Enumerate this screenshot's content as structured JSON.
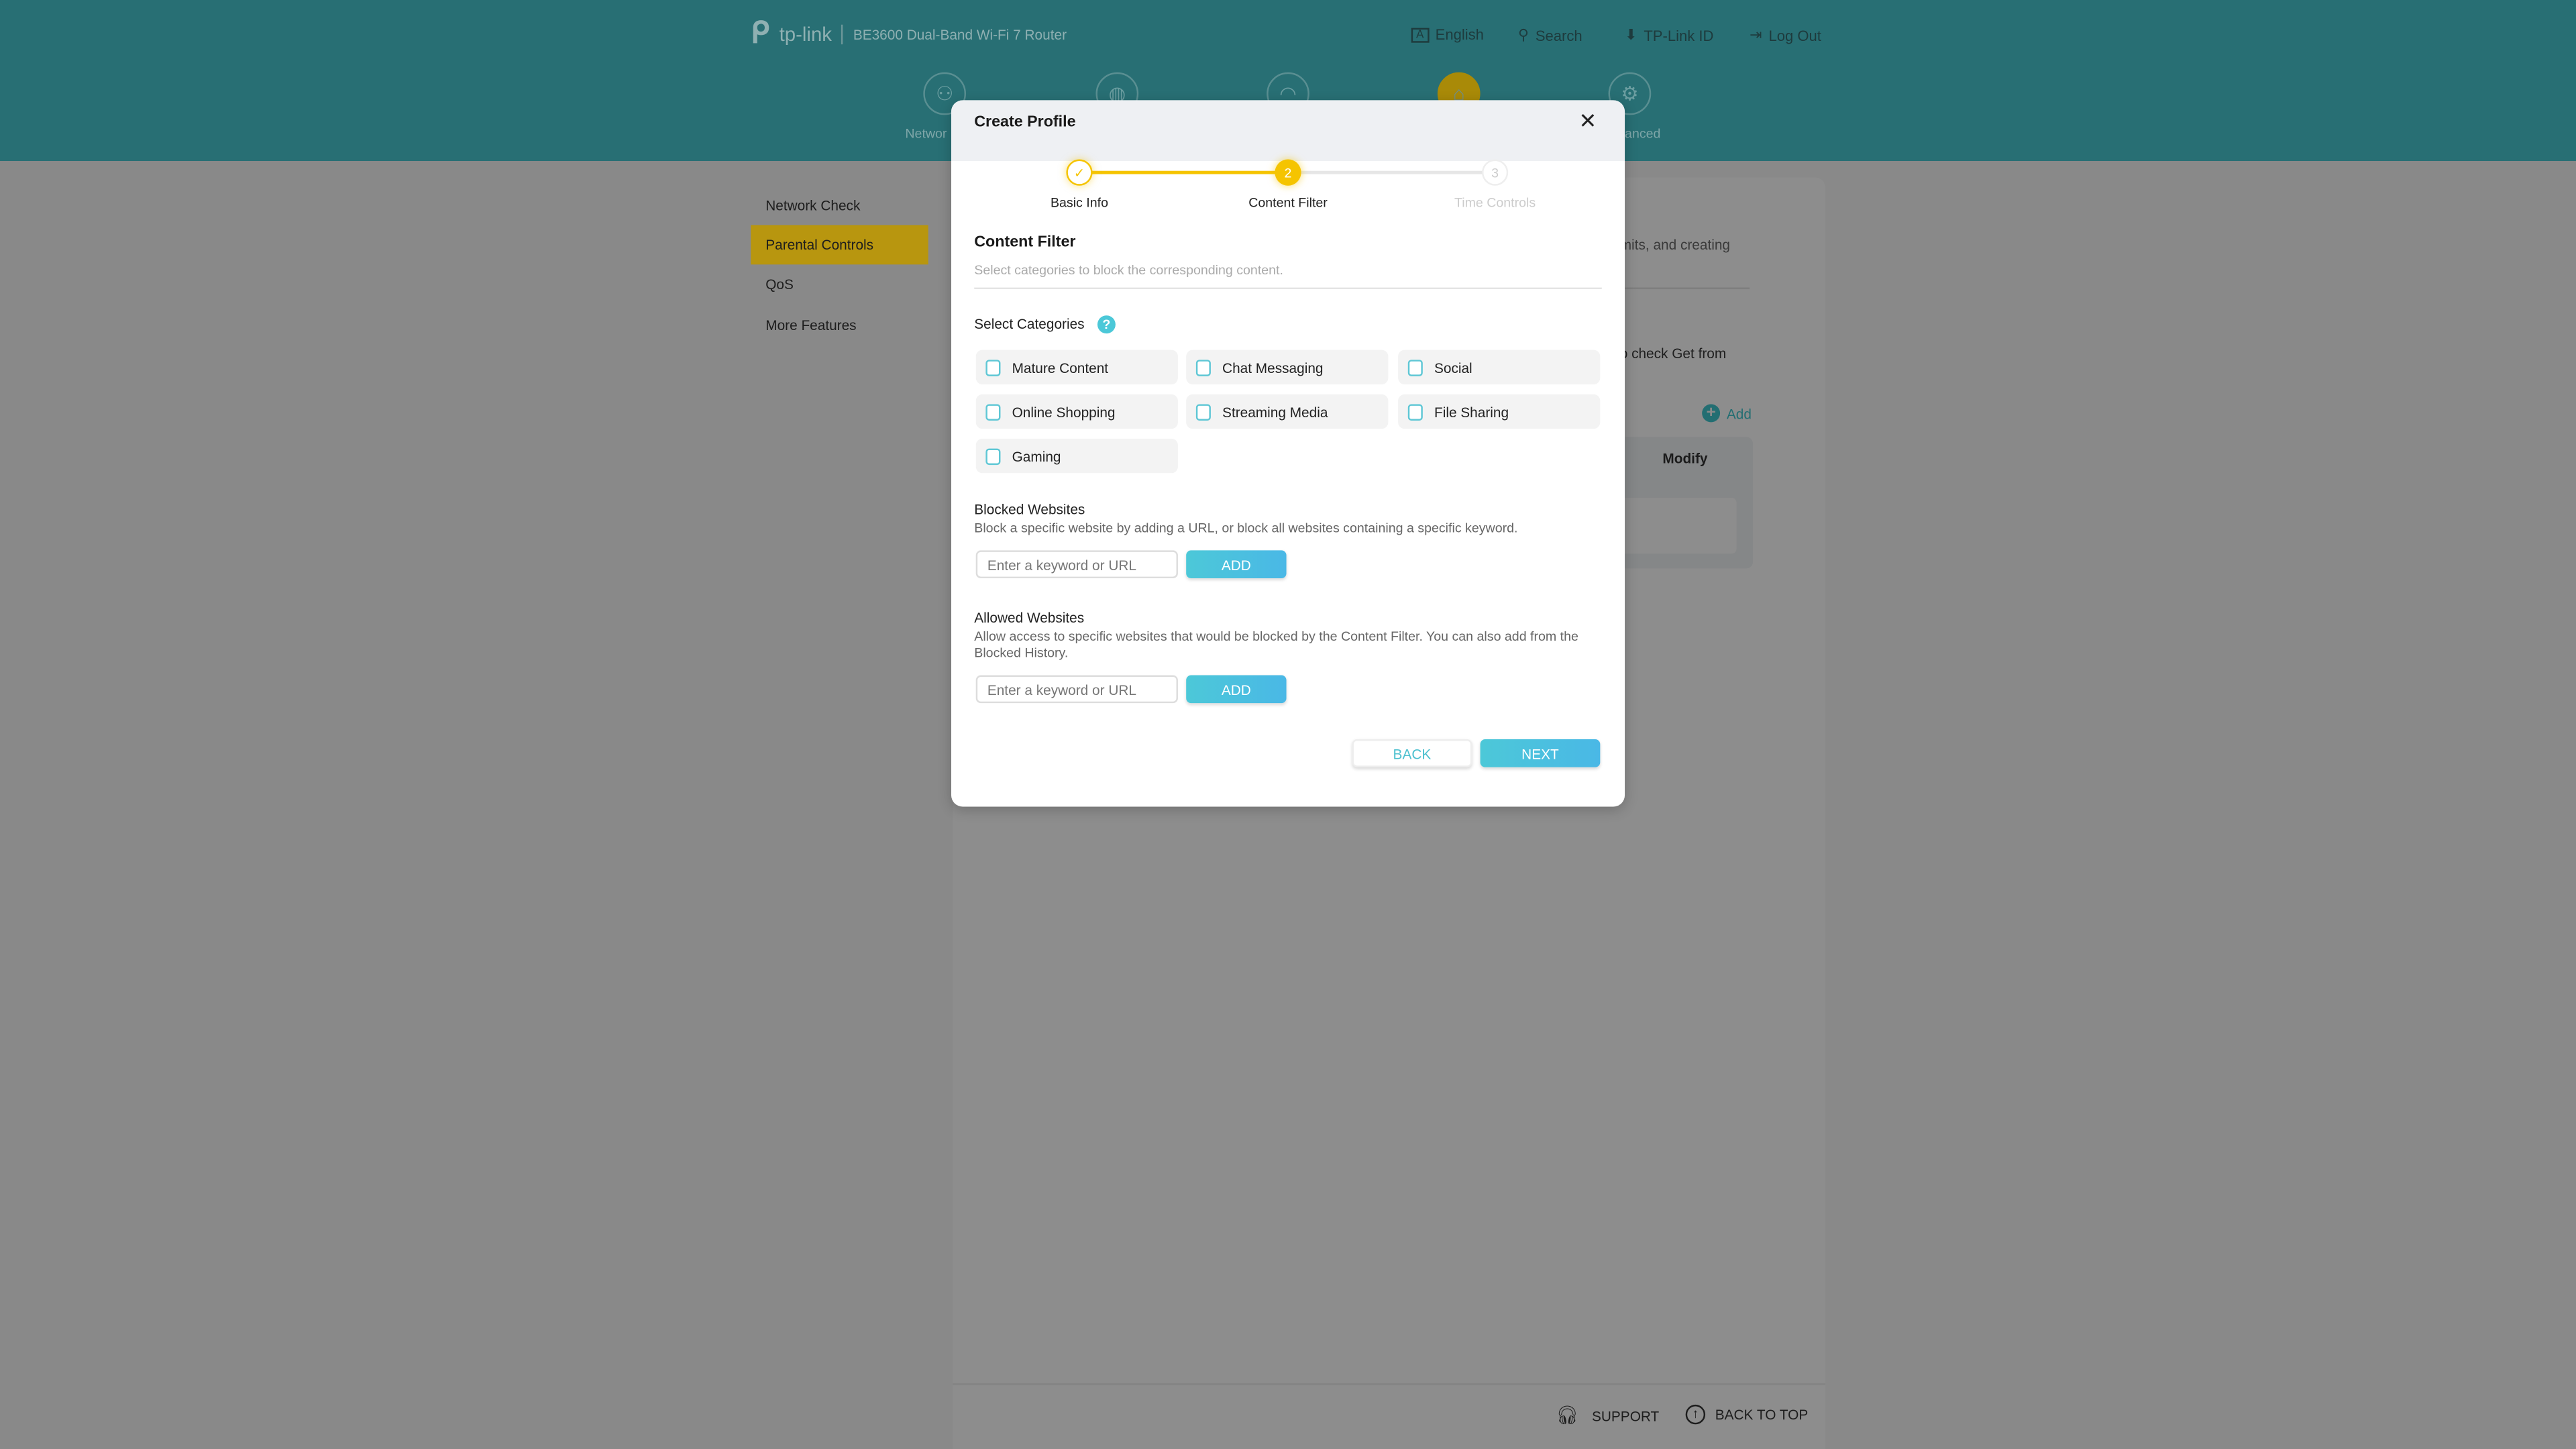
{
  "header": {
    "brand": "tp-link",
    "model": "BE3600 Dual-Band Wi-Fi 7 Router",
    "links": [
      {
        "label": "English",
        "icon": "language-icon"
      },
      {
        "label": "Search",
        "icon": "search-icon"
      },
      {
        "label": "TP-Link ID",
        "icon": "tplink-id-icon"
      },
      {
        "label": "Log Out",
        "icon": "logout-icon"
      }
    ],
    "nav": [
      {
        "label": "Networ",
        "icon": "network-icon"
      },
      {
        "label": "",
        "icon": "internet-icon"
      },
      {
        "label": "",
        "icon": "wireless-icon"
      },
      {
        "label": "",
        "icon": "homeshield-icon",
        "active": true
      },
      {
        "label": "anced",
        "icon": "advanced-icon"
      }
    ]
  },
  "sidebar": {
    "items": [
      {
        "label": "Network Check"
      },
      {
        "label": "Parental Controls",
        "active": true
      },
      {
        "label": "QoS"
      },
      {
        "label": "More Features"
      }
    ]
  },
  "background": {
    "intro_fragment": "mits, and creating",
    "note_fragment": "o check Get from",
    "add_label": "Add",
    "table_header_modify": "Modify"
  },
  "footer": {
    "support": "SUPPORT",
    "back_to_top": "BACK TO TOP"
  },
  "modal": {
    "title": "Create Profile",
    "steps": [
      {
        "number": "1",
        "label": "Basic Info",
        "state": "done"
      },
      {
        "number": "2",
        "label": "Content Filter",
        "state": "current"
      },
      {
        "number": "3",
        "label": "Time Controls",
        "state": "pending"
      }
    ],
    "section_title": "Content Filter",
    "section_desc": "Select categories to block the corresponding content.",
    "categories_label": "Select Categories",
    "categories": [
      {
        "label": "Mature Content",
        "checked": false
      },
      {
        "label": "Chat Messaging",
        "checked": false
      },
      {
        "label": "Social",
        "checked": false
      },
      {
        "label": "Online Shopping",
        "checked": false
      },
      {
        "label": "Streaming Media",
        "checked": false
      },
      {
        "label": "File Sharing",
        "checked": false
      },
      {
        "label": "Gaming",
        "checked": false
      }
    ],
    "blocked": {
      "title": "Blocked Websites",
      "desc": "Block a specific website by adding a URL, or block all websites containing a specific keyword.",
      "placeholder": "Enter a keyword or URL",
      "value": "",
      "add": "ADD"
    },
    "allowed": {
      "title": "Allowed Websites",
      "desc": "Allow access to specific websites that would be blocked by the Content Filter. You can also add from the Blocked History.",
      "placeholder": "Enter a keyword or URL",
      "value": "",
      "add": "ADD"
    },
    "back": "BACK",
    "next": "NEXT"
  },
  "colors": {
    "accent": "#4cc8d8",
    "brand_teal": "#2a8a93",
    "active_yellow": "#f5c400",
    "overlay_gray": "#898989"
  }
}
